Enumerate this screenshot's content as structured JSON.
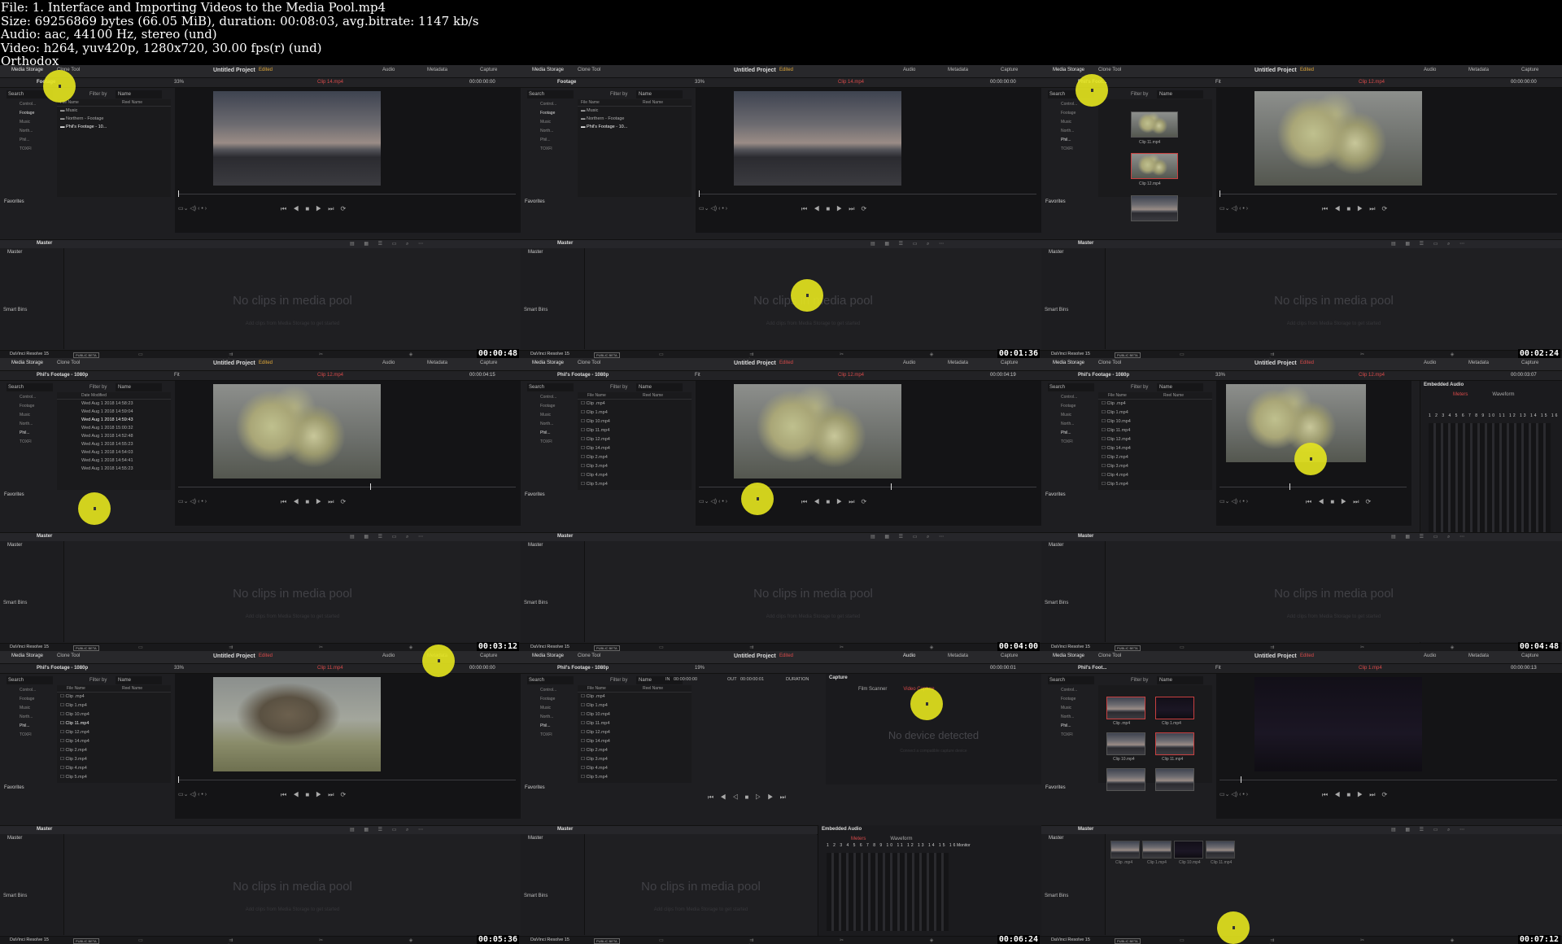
{
  "header": {
    "lines": [
      "File: 1. Interface and Importing Videos to the Media Pool.mp4",
      "Size: 69256869 bytes (66.05 MiB), duration: 00:08:03, avg.bitrate: 1147 kb/s",
      "Audio: aac, 44100 Hz, stereo (und)",
      "Video: h264, yuv420p, 1280x720, 30.00 fps(r) (und)",
      "Orthodox"
    ]
  },
  "app": {
    "name": "DaVinci Resolve 15",
    "badge": "PUBLIC BETA",
    "project": "Untitled Project",
    "edited": "Edited",
    "tabs": {
      "media_storage": "Media Storage",
      "clone_tool": "Clone Tool",
      "audio": "Audio",
      "metadata": "Metadata",
      "capture": "Capture"
    },
    "search": "Search",
    "filter_by": "Filter by",
    "filter_value": "Name",
    "favorites": "Favorites",
    "master": "Master",
    "smart_bins": "Smart Bins",
    "no_clips": "No clips in media pool",
    "add_clips": "Add clips from Media Storage to get started",
    "file_name_col": "File Name",
    "reel_name_col": "Reel Name",
    "date_modified_col": "Date Modified",
    "embedded_audio": "Embedded Audio",
    "meters": "Meters",
    "waveform": "Waveform",
    "monitor": "Monitor",
    "meter_nums": "1 2 3 4 5 6 7 8 9 10 11 12 13 14 15 16",
    "capture_title": "Capture",
    "film_scanner": "Film Scanner",
    "video_capture": "Video Capture",
    "no_device": "No device detected",
    "connect_device": "Connect a compatible capture device",
    "in_label": "IN",
    "out_label": "OUT",
    "duration_label": "DURATION",
    "in_tc": "00:00:00:00",
    "out_tc": "00:00:00:01",
    "dur_tc": "00:00:00:01"
  },
  "tree": {
    "items": [
      "Control...",
      "Footage",
      "Music",
      "North...",
      "Phil...",
      "TOXFI"
    ]
  },
  "folders": [
    "Music",
    "Northern - Footage",
    "Phil's Footage - 10..."
  ],
  "clips": [
    "Clip .mp4",
    "Clip 1.mp4",
    "Clip 10.mp4",
    "Clip 11.mp4",
    "Clip 12.mp4",
    "Clip 14.mp4",
    "Clip 2.mp4",
    "Clip 3.mp4",
    "Clip 4.mp4",
    "Clip 5.mp4"
  ],
  "dates": [
    "Wed Aug 1 2018 14:58:23",
    "Wed Aug 1 2018 14:59:04",
    "Wed Aug 1 2018 14:59:43",
    "Wed Aug 1 2018 15:00:32",
    "Wed Aug 1 2018 14:52:48",
    "Wed Aug 1 2018 14:55:23",
    "Wed Aug 1 2018 14:54:03",
    "Wed Aug 1 2018 14:54:41",
    "Wed Aug 1 2018 14:55:23"
  ],
  "tiles": [
    {
      "path": "Footage",
      "zoom": "33%",
      "clip_title": "Clip 14.mp4",
      "tc": "00:00:00:00",
      "edited_color": "orange",
      "timestamp": ""
    },
    {
      "path": "Footage",
      "zoom": "33%",
      "clip_title": "Clip 14.mp4",
      "tc": "00:00:00:00",
      "edited_color": "orange",
      "timestamp": "00:00:48"
    },
    {
      "path": "Phil's Foot...",
      "zoom": "Fit",
      "clip_title": "Clip 12.mp4",
      "tc": "00:00:00:00",
      "edited_color": "orange",
      "timestamp": "00:01:36"
    },
    {
      "path": "Phil's Footage - 1080p",
      "zoom": "Fit",
      "clip_title": "Clip 12.mp4",
      "tc": "00:00:04:15",
      "edited_color": "orange",
      "timestamp": "00:02:24"
    },
    {
      "path": "Phil's Footage - 1080p",
      "zoom": "Fit",
      "clip_title": "Clip 12.mp4",
      "tc": "00:00:04:19",
      "edited_color": "red",
      "timestamp": "00:03:12"
    },
    {
      "path": "Phil's Footage - 1080p",
      "zoom": "33%",
      "clip_title": "Clip 12.mp4",
      "tc": "00:00:03:07",
      "edited_color": "red",
      "timestamp": "00:04:00"
    },
    {
      "path": "Phil's Footage - 1080p",
      "zoom": "33%",
      "clip_title": "Clip 11.mp4",
      "tc": "00:00:00:00",
      "edited_color": "red",
      "timestamp": "00:04:48"
    },
    {
      "path": "Phil's Footage - 1080p",
      "zoom": "19%",
      "clip_title": "",
      "tc": "00:00:00:01",
      "edited_color": "red",
      "timestamp": "00:05:36"
    },
    {
      "path": "Phil's Foot...",
      "zoom": "Fit",
      "clip_title": "Clip 1.mp4",
      "tc": "00:00:00:13",
      "edited_color": "red",
      "timestamp": "00:06:24"
    }
  ],
  "last_timestamp": "00:07:12",
  "grid_thumbs": [
    "Clip .mp4",
    "Clip 1.mp4",
    "Clip 10.mp4",
    "Clip 11.mp4"
  ],
  "colors": {
    "accent_red": "#d84a4a",
    "edited_orange": "#e0a83a",
    "cursor_yellow": "#e6e61e"
  }
}
